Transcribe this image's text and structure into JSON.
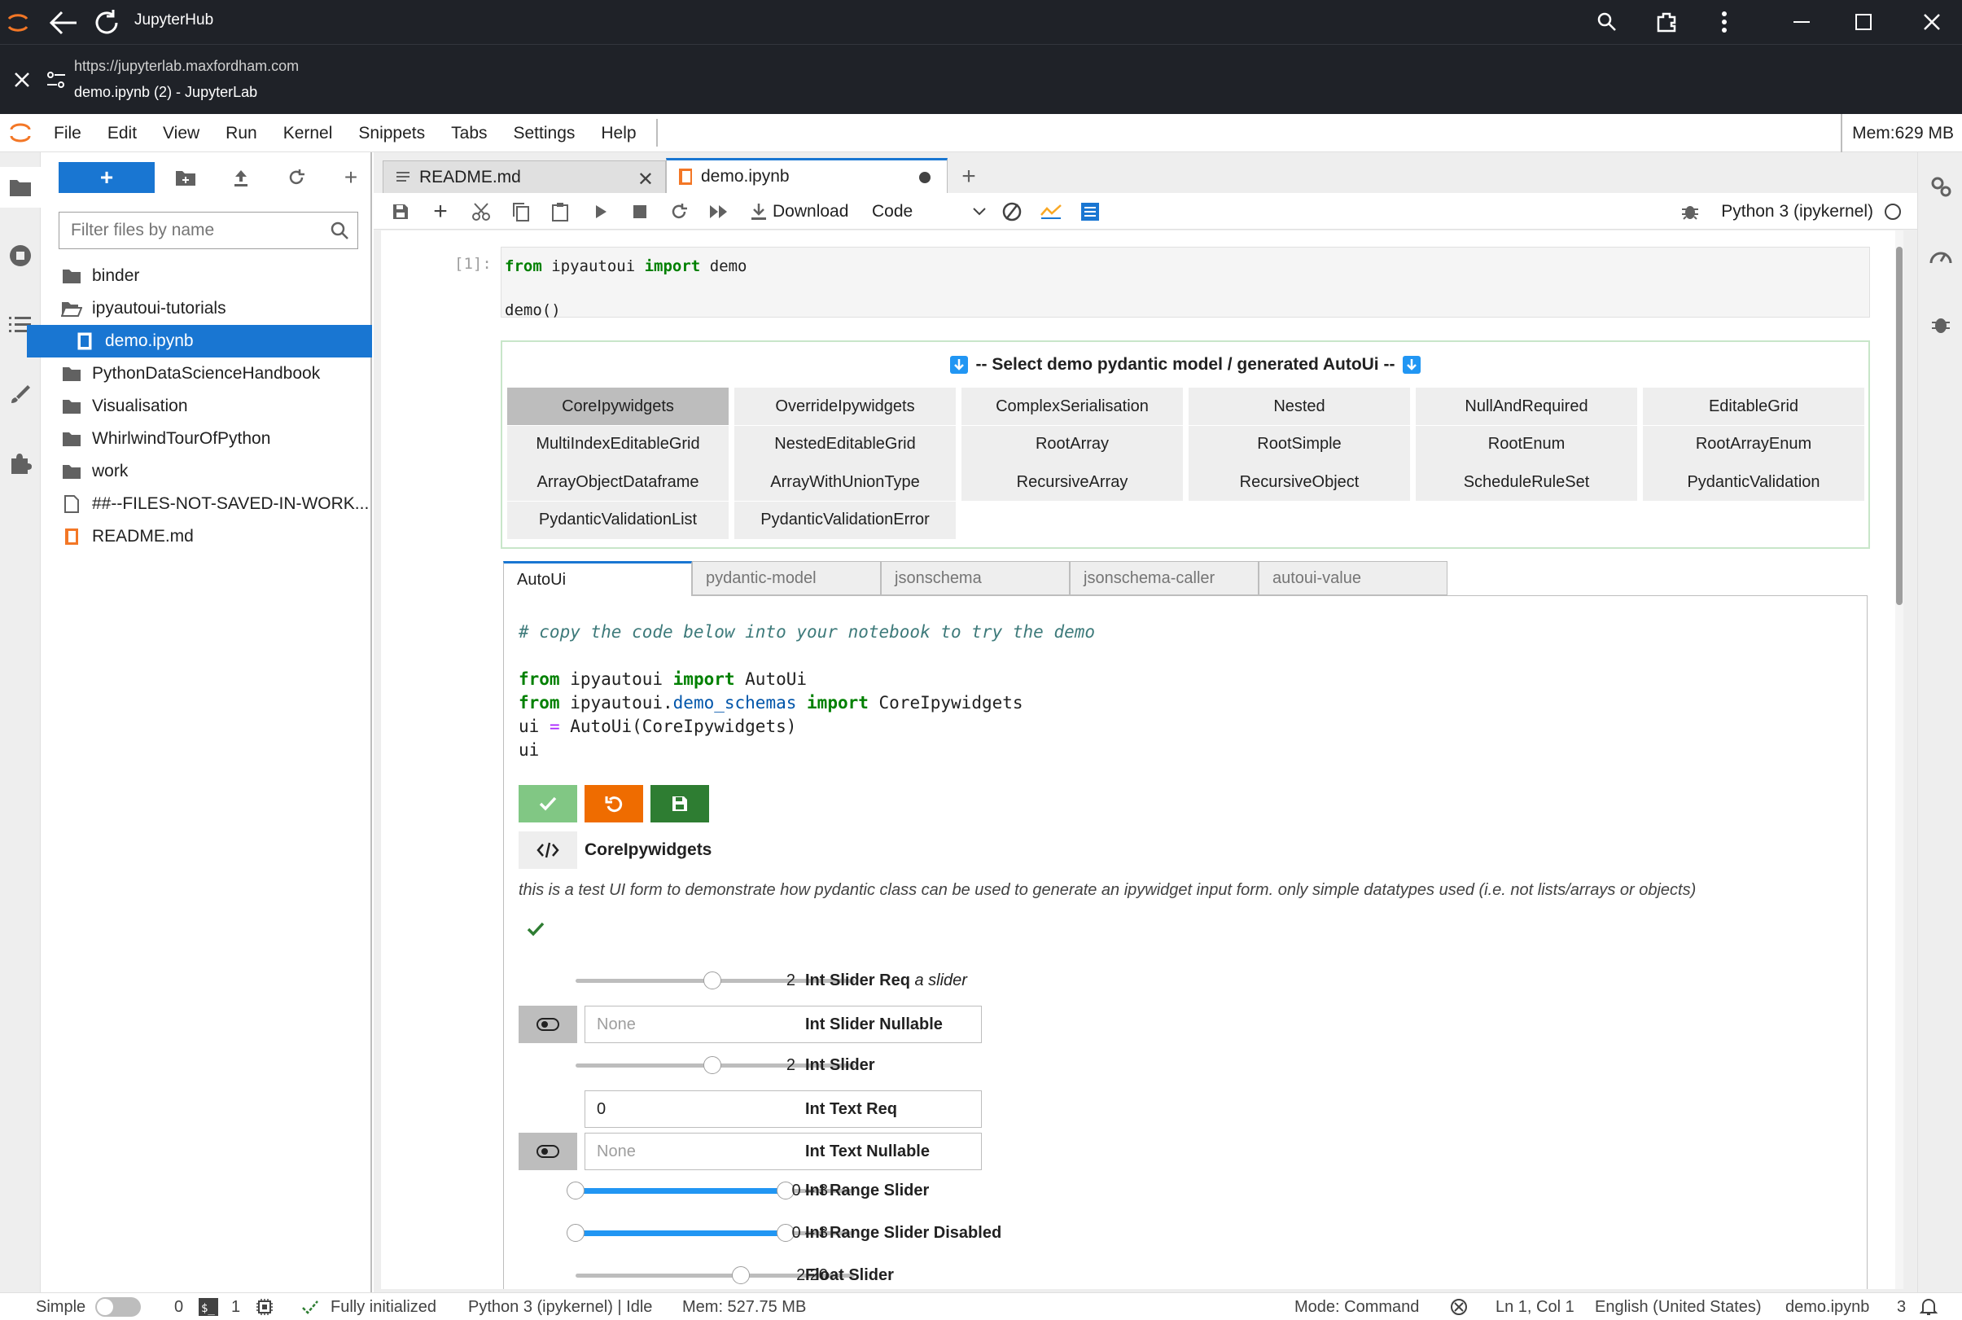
{
  "browser": {
    "app_name": "JupyterHub",
    "url": "https://jupyterlab.maxfordham.com",
    "page_title": "demo.ipynb (2) - JupyterLab"
  },
  "menu": [
    "File",
    "Edit",
    "View",
    "Run",
    "Kernel",
    "Snippets",
    "Tabs",
    "Settings",
    "Help"
  ],
  "mem_top": "Mem:629 MB",
  "filebrowser": {
    "new_label": "+",
    "filter_placeholder": "Filter files by name",
    "items": [
      {
        "name": "binder",
        "icon": "folder-icon"
      },
      {
        "name": "ipyautoui-tutorials",
        "icon": "folder-open-icon"
      },
      {
        "name": "demo.ipynb",
        "icon": "notebook-icon"
      },
      {
        "name": "PythonDataScienceHandbook",
        "icon": "folder-icon"
      },
      {
        "name": "Visualisation",
        "icon": "folder-icon"
      },
      {
        "name": "WhirlwindTourOfPython",
        "icon": "folder-icon"
      },
      {
        "name": "work",
        "icon": "folder-icon"
      },
      {
        "name": "##--FILES-NOT-SAVED-IN-WORK...",
        "icon": "file-icon"
      },
      {
        "name": "README.md",
        "icon": "markdown-icon"
      }
    ]
  },
  "tabs": [
    {
      "label": "README.md"
    },
    {
      "label": "demo.ipynb"
    }
  ],
  "toolbar": {
    "download": "Download",
    "cell_type": "Code",
    "kernel": "Python 3 (ipykernel)"
  },
  "cell": {
    "prompt": "[1]:",
    "line1_kw1": "from",
    "line1_mod": " ipyautoui ",
    "line1_kw2": "import",
    "line1_rest": " demo",
    "line2": "demo()"
  },
  "output": {
    "select_title": "-- Select demo pydantic model / generated AutoUi --",
    "demo_buttons": [
      "CoreIpywidgets",
      "OverrideIpywidgets",
      "ComplexSerialisation",
      "Nested",
      "NullAndRequired",
      "EditableGrid",
      "MultiIndexEditableGrid",
      "NestedEditableGrid",
      "RootArray",
      "RootSimple",
      "RootEnum",
      "RootArrayEnum",
      "ArrayObjectDataframe",
      "ArrayWithUnionType",
      "RecursiveArray",
      "RecursiveObject",
      "ScheduleRuleSet",
      "PydanticValidation",
      "PydanticValidationList",
      "PydanticValidationError"
    ],
    "selected_demo": "CoreIpywidgets",
    "output_tabs": [
      "AutoUi",
      "pydantic-model",
      "jsonschema",
      "jsonschema-caller",
      "autoui-value"
    ],
    "code_comment": "# copy the code below into your notebook to try the demo",
    "code": {
      "l1_kw1": "from",
      "l1_a": " ipyautoui ",
      "l1_kw2": "import",
      "l1_b": " AutoUi",
      "l2_kw1": "from",
      "l2_a": " ipyautoui.",
      "l2_mod": "demo_schemas",
      "l2_sp": " ",
      "l2_kw2": "import",
      "l2_b": " CoreIpywidgets",
      "l3_a": "ui ",
      "l3_op": "=",
      "l3_b": " AutoUi(CoreIpywidgets)",
      "l4": "ui"
    },
    "form_title": "CoreIpywidgets",
    "form_description": "this is a test UI form to demonstrate how pydantic class can be used to generate an ipywidget input form. only simple datatypes used (i.e. not lists/arrays or objects)",
    "rows": {
      "int_slider_req": {
        "label": "Int Slider Req",
        "desc": "a slider",
        "value": "2",
        "level": 0.5
      },
      "int_slider_nullable": {
        "label": "Int Slider Nullable",
        "placeholder": "None"
      },
      "int_slider": {
        "label": "Int Slider",
        "value": "2",
        "level": 0.5
      },
      "int_text_req": {
        "label": "Int Text Req",
        "value": "0"
      },
      "int_text_nullable": {
        "label": "Int Text Nullable",
        "placeholder": "None"
      },
      "int_range_slider": {
        "label": "Int Range Slider",
        "value": "0 – 3",
        "range": [
          0,
          0.75
        ]
      },
      "int_range_slider_disabled": {
        "label": "Int Range Slider Disabled",
        "value": "0 – 3",
        "range": [
          0,
          0.75
        ]
      },
      "float_slider": {
        "label": "Float Slider",
        "value": "2.20",
        "level": 0.6
      }
    }
  },
  "status": {
    "mode_simple": "Simple",
    "terminals": "0",
    "kernels": "1",
    "init": "Fully initialized",
    "kernel_state": "Python 3 (ipykernel) | Idle",
    "mem": "Mem: 527.75 MB",
    "command_mode": "Mode: Command",
    "cursor": "Ln 1, Col 1",
    "language": "English (United States)",
    "file": "demo.ipynb",
    "notifications": "3"
  },
  "colors": {
    "accent": "#1976d2",
    "save_green": "#2e7d32",
    "revert_orange": "#ef6c00",
    "valid_green": "#81c784"
  }
}
